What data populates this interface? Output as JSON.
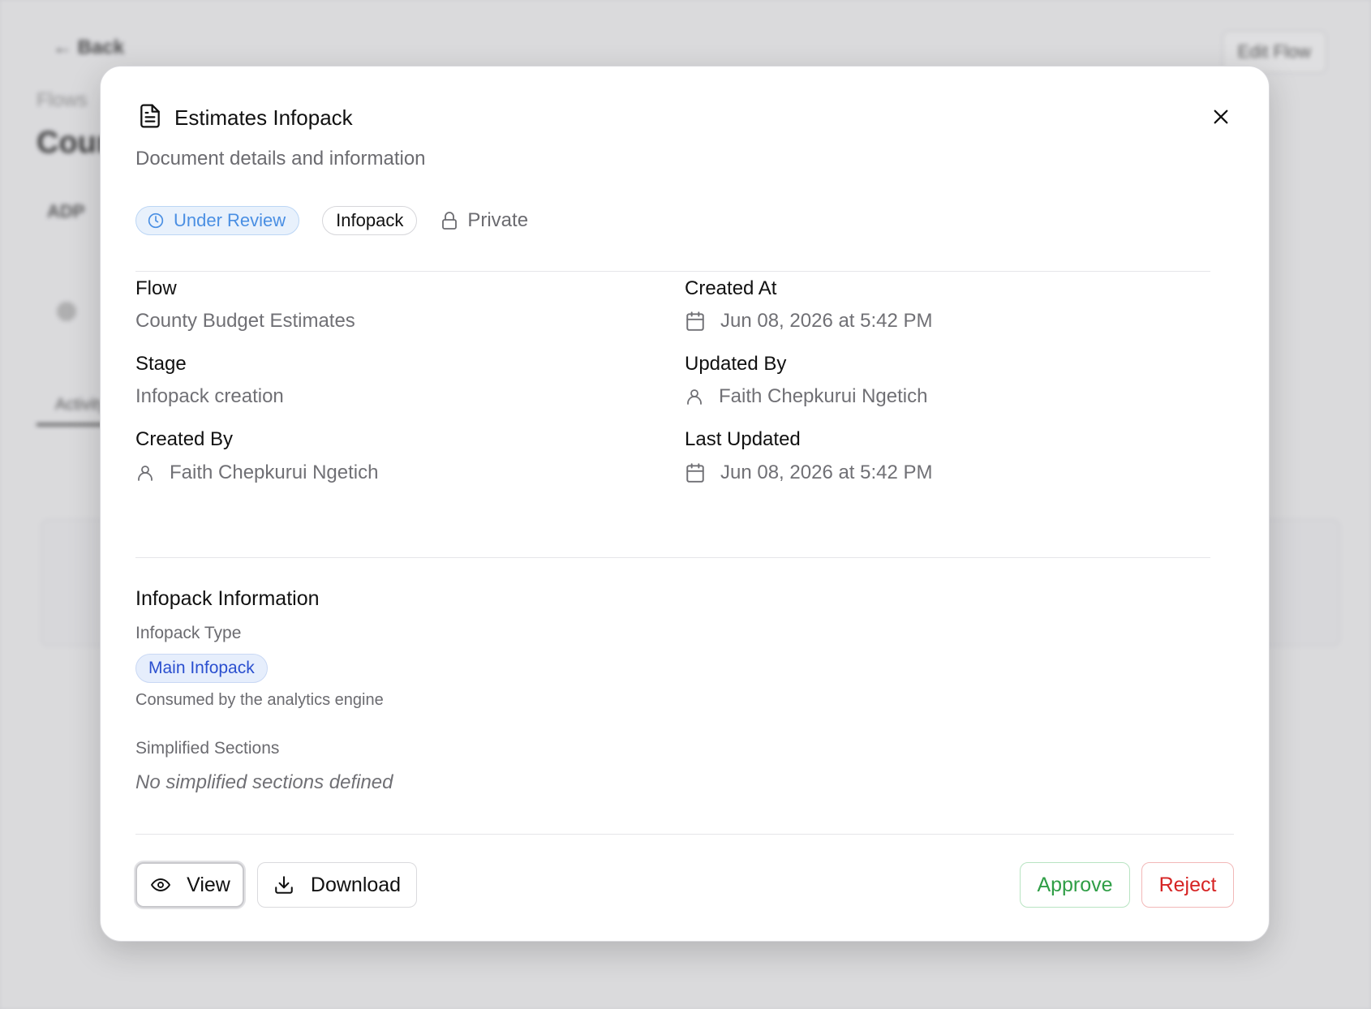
{
  "background": {
    "back_label": "Back",
    "edit_label": "Edit Flow",
    "breadcrumb": "Flows",
    "page_title": "County Budget Estimates",
    "code": "ADP",
    "tab_label": "Activity"
  },
  "modal": {
    "title": "Estimates Infopack",
    "subtitle": "Document details and information",
    "close_icon": "close-icon",
    "badges": {
      "status": "Under Review",
      "type": "Infopack",
      "visibility": "Private"
    },
    "fields": {
      "flow": {
        "label": "Flow",
        "value": "County Budget Estimates"
      },
      "stage": {
        "label": "Stage",
        "value": "Infopack creation"
      },
      "created_by": {
        "label": "Created By",
        "value": "Faith Chepkurui Ngetich"
      },
      "created_at": {
        "label": "Created At",
        "value": "Jun 08, 2026 at 5:42 PM"
      },
      "updated_by": {
        "label": "Updated By",
        "value": "Faith Chepkurui Ngetich"
      },
      "last_updated": {
        "label": "Last Updated",
        "value": "Jun 08, 2026 at 5:42 PM"
      }
    },
    "infopack_info": {
      "title": "Infopack Information",
      "type_label": "Infopack Type",
      "type_value": "Main Infopack",
      "type_description": "Consumed by the analytics engine",
      "simplified_label": "Simplified Sections",
      "simplified_empty": "No simplified sections defined"
    },
    "actions": {
      "view": "View",
      "download": "Download",
      "approve": "Approve",
      "reject": "Reject"
    }
  },
  "colors": {
    "status_blue": "#4a8fe3",
    "pill_blue": "#2a4fcf",
    "approve_green": "#2f9e46",
    "reject_red": "#d62424"
  }
}
